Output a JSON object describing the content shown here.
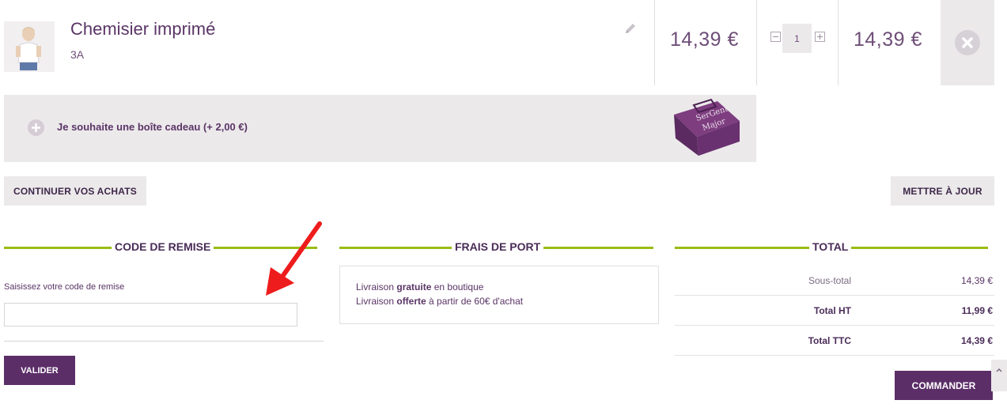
{
  "cart_item": {
    "name": "Chemisier imprimé",
    "size": "3A",
    "unit_price": "14,39 €",
    "quantity": "1",
    "total_price": "14,39 €"
  },
  "gift_box": {
    "label": "Je souhaite une boîte cadeau (+ 2,00 €)",
    "box_logo_line1": "SerGent",
    "box_logo_line2": "Major"
  },
  "actions": {
    "continue_label": "CONTINUER VOS ACHATS",
    "update_label": "METTRE À JOUR"
  },
  "discount": {
    "title": "CODE DE REMISE",
    "field_label": "Saisissez votre code de remise",
    "field_value": "",
    "submit_label": "VALIDER"
  },
  "shipping": {
    "title": "FRAIS DE PORT",
    "line1_pre": "Livraison ",
    "line1_bold": "gratuite",
    "line1_post": " en boutique",
    "line2_pre": "Livraison ",
    "line2_bold": "offerte",
    "line2_post": " à partir de 60€ d'achat"
  },
  "totals": {
    "title": "TOTAL",
    "rows": [
      {
        "label": "Sous-total",
        "value": "14,39 €"
      },
      {
        "label": "Total HT",
        "value": "11,99 €"
      },
      {
        "label": "Total TTC",
        "value": "14,39 €"
      }
    ],
    "order_label": "COMMANDER"
  },
  "colors": {
    "brand_purple": "#5c2e68",
    "accent_green": "#99bc14",
    "arrow_red": "#ee1c1c"
  }
}
